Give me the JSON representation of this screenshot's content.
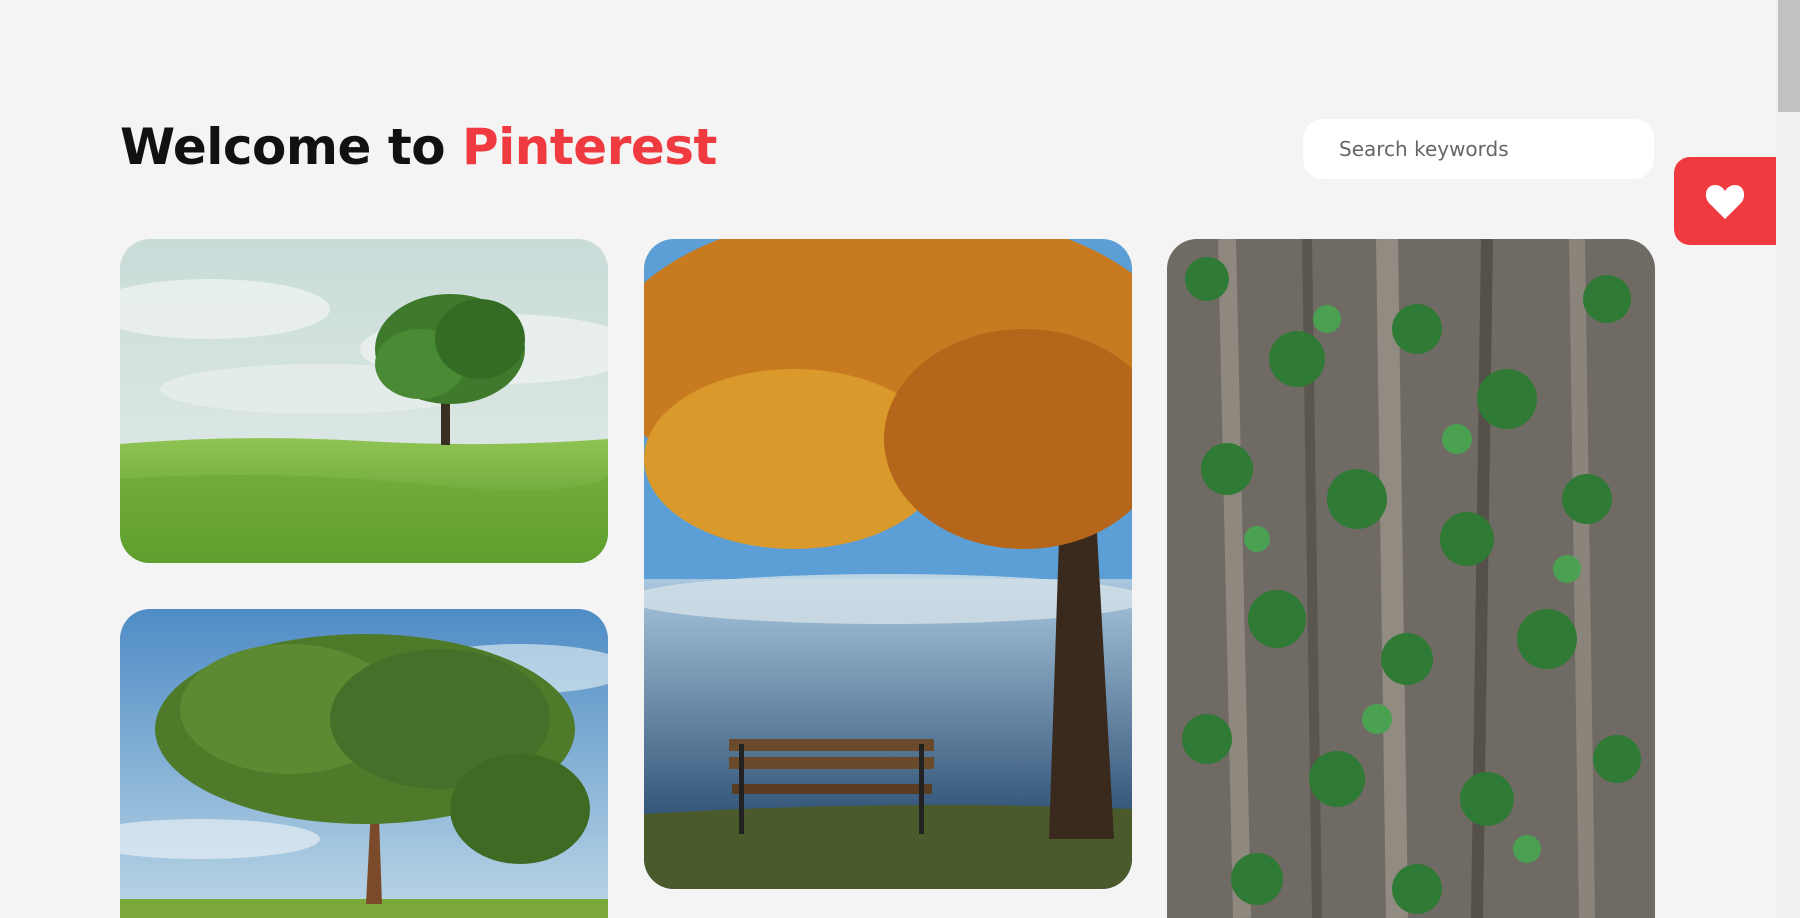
{
  "header": {
    "title_prefix": "Welcome to",
    "title_brand": "Pinterest",
    "brand_color": "#ef3b3f"
  },
  "search": {
    "placeholder": "Search keywords"
  },
  "favorites": {
    "icon": "heart-icon"
  },
  "gallery": {
    "images": [
      {
        "subject": "lone-tree-on-grassland"
      },
      {
        "subject": "large-green-tree-blue-sky"
      },
      {
        "subject": "autumn-tree-bench-by-lake"
      },
      {
        "subject": "ivy-on-tree-bark"
      }
    ]
  }
}
